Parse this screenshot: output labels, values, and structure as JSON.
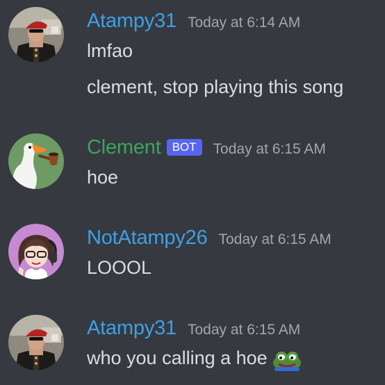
{
  "messages": [
    {
      "author": "Atampy31",
      "author_color": "#3ea0e5",
      "timestamp": "Today at 6:14 AM",
      "avatar_icon": "soldier-avatar",
      "lines": [
        "lmfao",
        "clement, stop playing this song"
      ]
    },
    {
      "author": "Clement",
      "author_color": "#3ba55d",
      "bot_tag": "BOT",
      "timestamp": "Today at 6:15 AM",
      "avatar_icon": "goose-with-pipe-avatar",
      "lines": [
        "hoe"
      ]
    },
    {
      "author": "NotAtampy26",
      "author_color": "#3ea0e5",
      "timestamp": "Today at 6:15 AM",
      "avatar_icon": "anime-girl-headphones-avatar",
      "lines": [
        "LOOOL"
      ]
    },
    {
      "author": "Atampy31",
      "author_color": "#3ea0e5",
      "timestamp": "Today at 6:15 AM",
      "avatar_icon": "soldier-avatar",
      "lines": [
        "who you calling a hoe"
      ],
      "emoji": "peepo-frog-emoji"
    }
  ],
  "colors": {
    "background": "#36393f",
    "message_text": "#dcddde",
    "timestamp": "#a3a6aa",
    "bot_tag_bg": "#5865f2"
  }
}
